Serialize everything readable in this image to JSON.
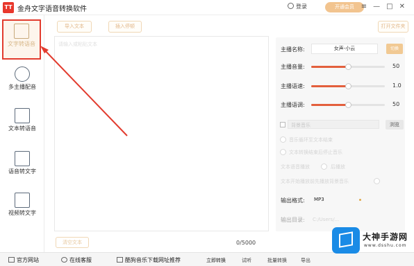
{
  "app": {
    "logo_text": "TT",
    "title": "金舟文字语音转换软件",
    "login_label": "登录",
    "vip_label": "开通会员",
    "window_controls": [
      "≡",
      "—",
      "□",
      "✕"
    ]
  },
  "sidebar": {
    "items": [
      {
        "label": "文字转语音",
        "icon": "text-to-speech-icon",
        "active": true
      },
      {
        "label": "多主播配音",
        "icon": "multi-anchor-icon",
        "active": false
      },
      {
        "label": "文本转语音",
        "icon": "document-to-speech-icon",
        "active": false
      },
      {
        "label": "语音转文字",
        "icon": "speech-to-text-icon",
        "active": false
      },
      {
        "label": "视频转文字",
        "icon": "video-to-text-icon",
        "active": false
      }
    ]
  },
  "toolbar": {
    "import_label": "导入文本",
    "pause_label": "插入停顿",
    "save_label": "打开文件夹"
  },
  "editor": {
    "placeholder": "请输入或粘贴文本",
    "clear_label": "清空文本",
    "counter": "0/5000"
  },
  "settings": {
    "anchor_label": "主播名称:",
    "anchor_value": "女声-小云",
    "change_label": "切换",
    "volume": {
      "label": "主播音量:",
      "value": "50",
      "fraction": 0.5
    },
    "speed": {
      "label": "主播语速:",
      "value": "1.0",
      "fraction": 0.5
    },
    "pitch": {
      "label": "主播语调:",
      "value": "50",
      "fraction": 0.5
    },
    "bgm_label": "背景音乐",
    "bgm_button": "浏览",
    "option_1": "音乐循环至文本结束",
    "option_2": "文本转换结束后停止音乐",
    "option_3_prefix": "文本语音播放",
    "option_3_suffix": "后播放",
    "option_4": "文本开始播放前先播放背景音乐",
    "format_label": "输出格式:",
    "format_value": "MP3",
    "output_dir_label": "输出目录:",
    "output_dir_value": "C:/Users/..."
  },
  "bottom": {
    "official_site": "官方网站",
    "online_service": "在线客服",
    "recommend": "酷狗音乐下载网址推荐",
    "start_convert": "立即转换",
    "preview": "试听",
    "batch": "批量转换",
    "export": "导出"
  },
  "watermark": {
    "brand": "大神手游网",
    "url": "www.dsshu.com"
  },
  "colors": {
    "accent": "#e35f3c",
    "highlight_border": "#e23b2e",
    "gold": "#e2b88a",
    "watermark_blue": "#1a8be6"
  }
}
